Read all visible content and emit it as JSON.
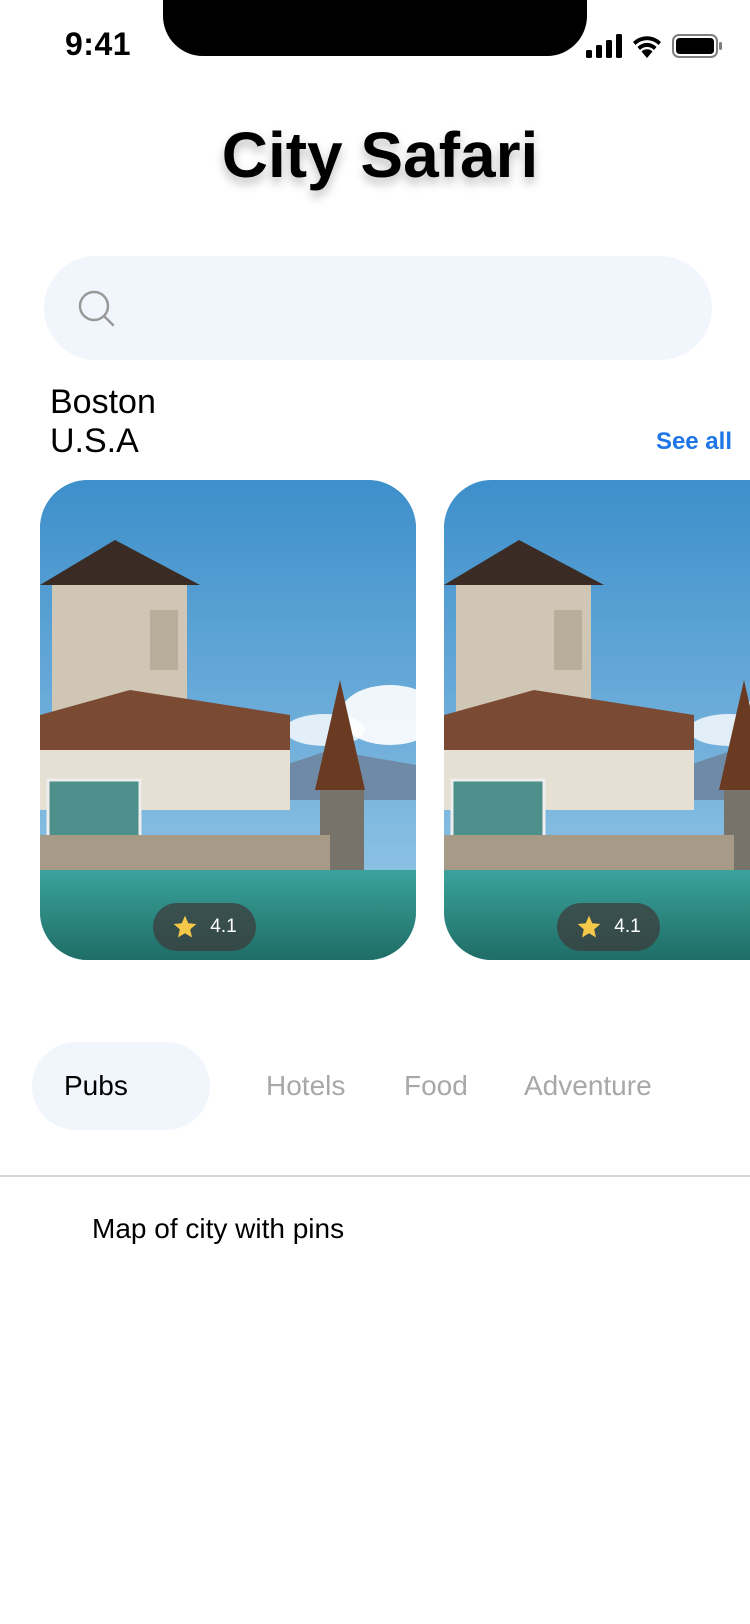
{
  "status_bar": {
    "time": "9:41"
  },
  "header": {
    "title": "City Safari"
  },
  "search": {
    "placeholder": ""
  },
  "location": {
    "city": "Boston",
    "country": "U.S.A",
    "see_all_label": "See all"
  },
  "cards": [
    {
      "rating": "4.1"
    },
    {
      "rating": "4.1"
    }
  ],
  "tabs": [
    {
      "label": "Pubs",
      "active": true
    },
    {
      "label": "Hotels",
      "active": false
    },
    {
      "label": "Food",
      "active": false
    },
    {
      "label": "Adventure",
      "active": false
    }
  ],
  "map": {
    "label": "Map of city with pins"
  },
  "colors": {
    "accent": "#1f76e6",
    "search_bg": "#f1f6fd",
    "star": "#f5c84a"
  }
}
